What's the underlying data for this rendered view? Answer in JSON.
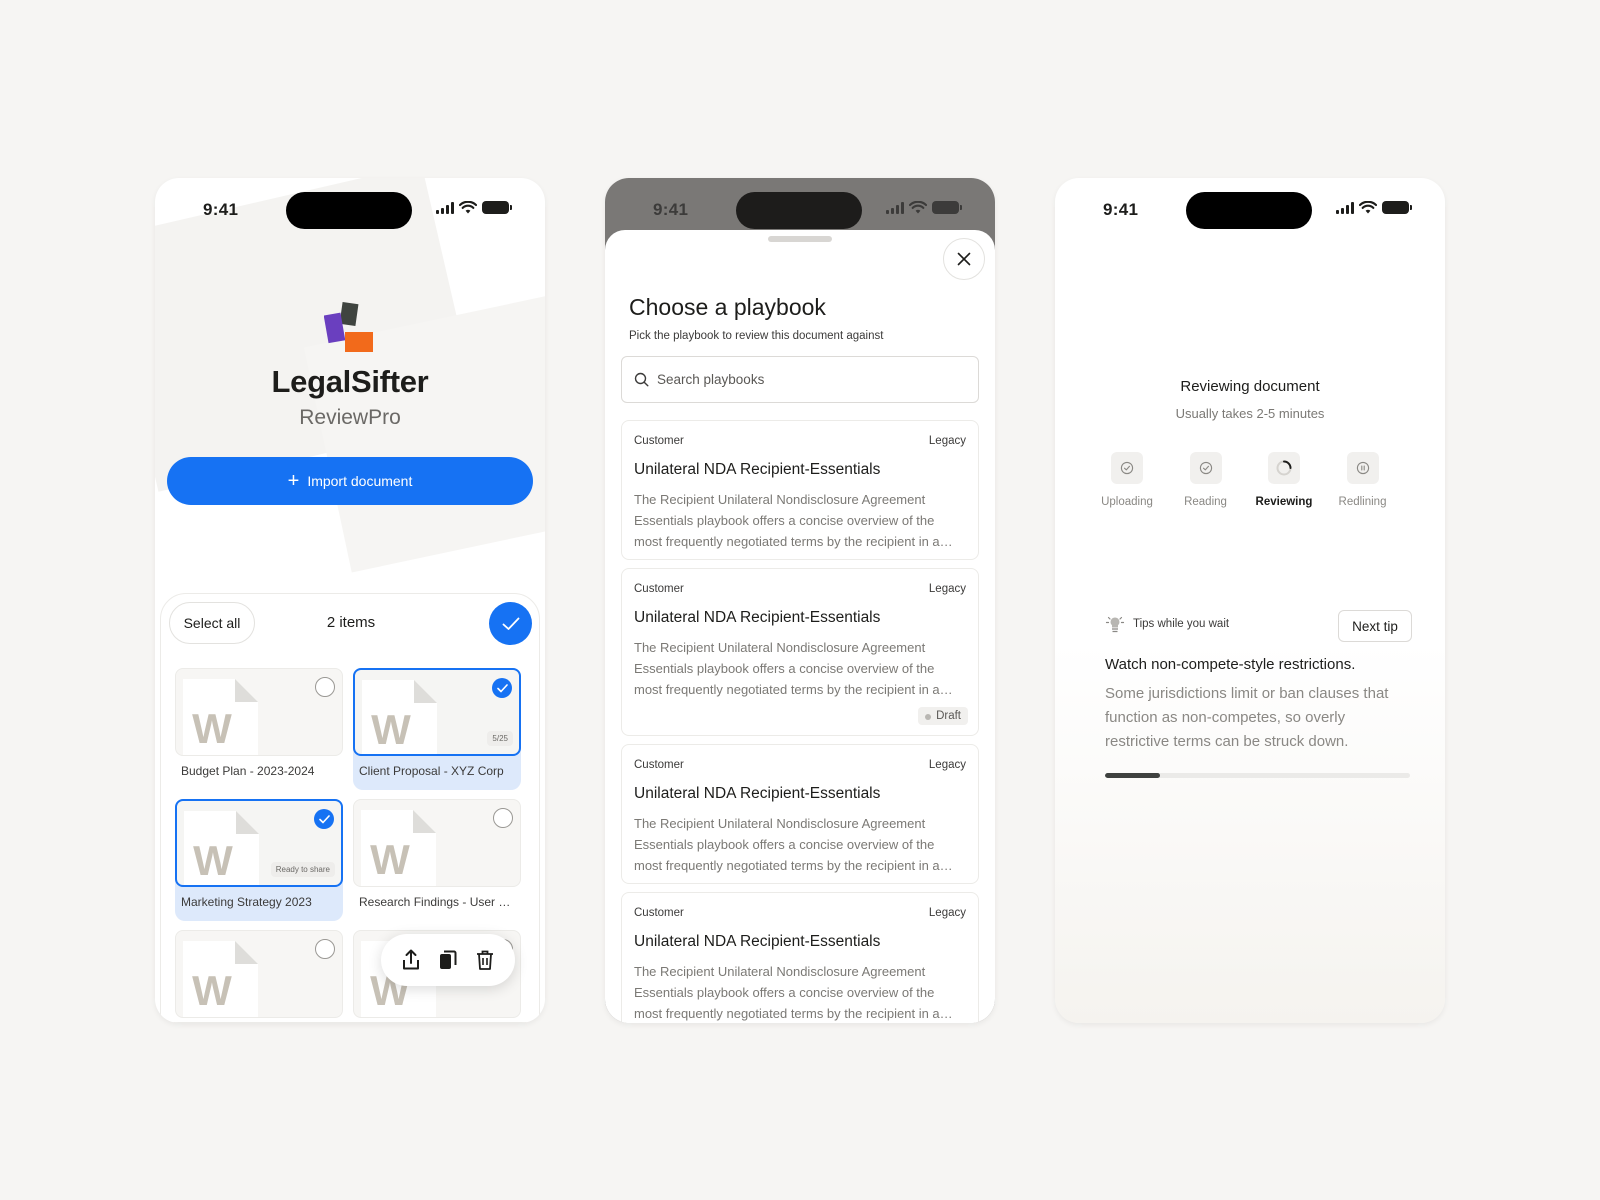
{
  "status": {
    "time": "9:41"
  },
  "home": {
    "brand": "LegalSifter",
    "product": "ReviewPro",
    "import_label": "Import document",
    "select_all": "Select all",
    "items_count": "2 items",
    "files": [
      {
        "name": "Budget Plan - 2023-2024",
        "selected": false,
        "badge": ""
      },
      {
        "name": "Client Proposal - XYZ Corp",
        "selected": true,
        "badge": "5/25"
      },
      {
        "name": "Marketing Strategy 2023",
        "selected": true,
        "badge": "Ready to share"
      },
      {
        "name": "Research Findings - User Experience",
        "selected": false,
        "badge": ""
      },
      {
        "name": "",
        "selected": false,
        "badge": ""
      },
      {
        "name": "",
        "selected": false,
        "badge": ""
      }
    ],
    "actions": [
      "share-icon",
      "copy-icon",
      "trash-icon"
    ]
  },
  "playbook": {
    "title": "Choose a playbook",
    "subtitle": "Pick the playbook to review this document against",
    "search_placeholder": "Search playbooks",
    "cards": [
      {
        "category": "Customer",
        "tag": "Legacy",
        "title": "Unilateral NDA Recipient-Essentials",
        "description": "The Recipient Unilateral Nondisclosure Agreement Essentials playbook offers a concise overview of the most frequently negotiated terms by the recipient in a unilateral NDA.",
        "badge": ""
      },
      {
        "category": "Customer",
        "tag": "Legacy",
        "title": "Unilateral NDA Recipient-Essentials",
        "description": "The Recipient Unilateral Nondisclosure Agreement Essentials playbook offers a concise overview of the most frequently negotiated terms by the recipient in a unilateral NDA.",
        "badge": "Draft"
      },
      {
        "category": "Customer",
        "tag": "Legacy",
        "title": "Unilateral NDA Recipient-Essentials",
        "description": "The Recipient Unilateral Nondisclosure Agreement Essentials playbook offers a concise overview of the most frequently negotiated terms by the recipient in a unilateral NDA.",
        "badge": ""
      },
      {
        "category": "Customer",
        "tag": "Legacy",
        "title": "Unilateral NDA Recipient-Essentials",
        "description": "The Recipient Unilateral Nondisclosure Agreement Essentials playbook offers a concise overview of the most frequently negotiated terms by the recipient in a unilateral NDA.",
        "badge": ""
      }
    ]
  },
  "review": {
    "title": "Reviewing document",
    "subtitle": "Usually takes 2-5 minutes",
    "steps": [
      {
        "label": "Uploading",
        "state": "done",
        "icon": "check-circle-icon"
      },
      {
        "label": "Reading",
        "state": "done",
        "icon": "check-circle-icon"
      },
      {
        "label": "Reviewing",
        "state": "active",
        "icon": "spinner-icon"
      },
      {
        "label": "Redlining",
        "state": "pending",
        "icon": "pause-circle-icon"
      }
    ],
    "tips_label": "Tips while you wait",
    "next_tip_label": "Next tip",
    "tip_title": "Watch non-compete-style restrictions.",
    "tip_body": "Some jurisdictions limit or ban clauses that function as non-competes, so overly restrictive terms can be struck down.",
    "tip_progress": 0.18
  },
  "colors": {
    "accent": "#1672f3",
    "logo_purple": "#6a3fbf",
    "logo_orange": "#f26a1b",
    "logo_dark": "#3f4440"
  }
}
